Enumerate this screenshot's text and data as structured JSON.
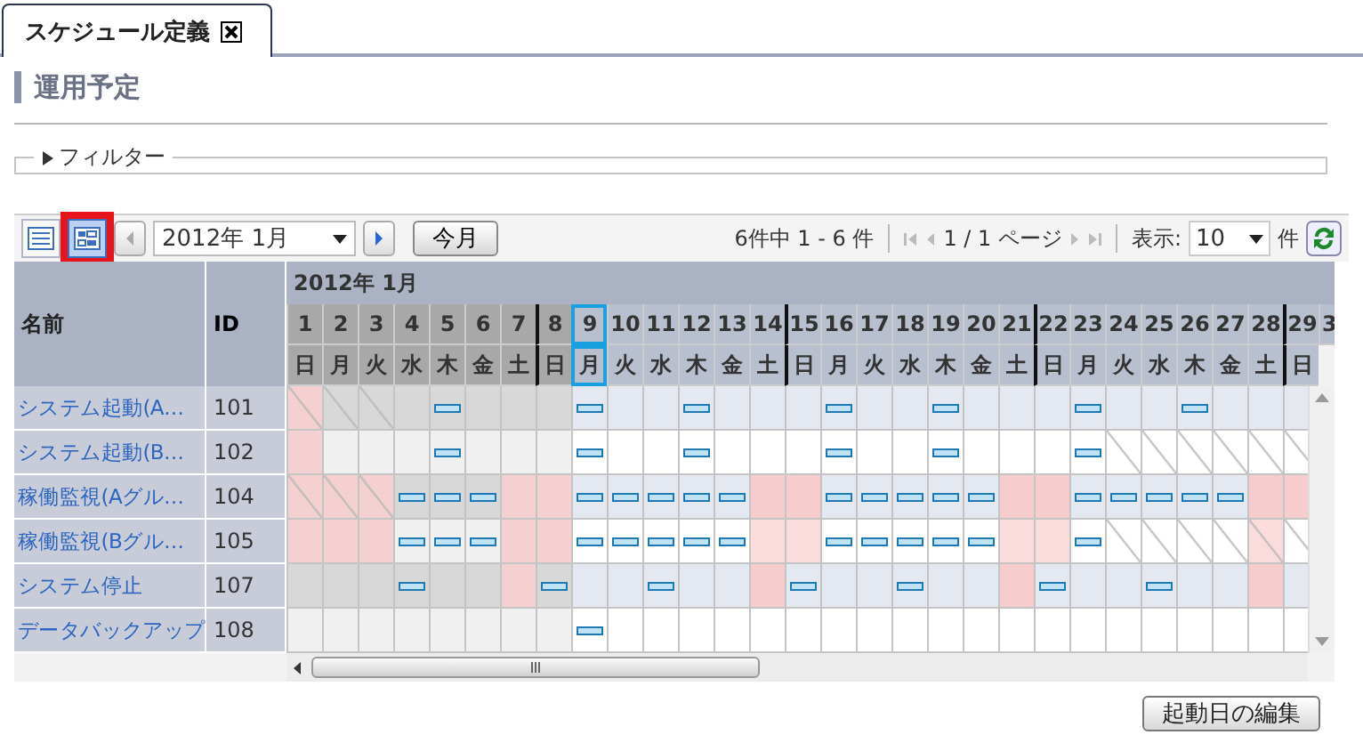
{
  "tab": {
    "label": "スケジュール定義",
    "selected": true
  },
  "heading": "運用予定",
  "filter": {
    "label": "フィルター",
    "expanded": false
  },
  "toolbar": {
    "views": [
      {
        "kind": "list",
        "selected": false,
        "highlighted": false
      },
      {
        "kind": "calendar",
        "selected": true,
        "highlighted": true
      }
    ],
    "month_select": "2012年  1月",
    "today_button": "今月",
    "count": "6件中 1 - 6 件",
    "page": "1 / 1 ページ",
    "page_size_label": "表示:",
    "page_size": "10",
    "page_size_unit": "件"
  },
  "calendar": {
    "name_header": "名前",
    "id_header": "ID",
    "month": "2012年  1月",
    "days": [
      {
        "date": "1",
        "weekday": "日",
        "past": true,
        "today": false,
        "week_start": false
      },
      {
        "date": "2",
        "weekday": "月",
        "past": true,
        "today": false,
        "week_start": false
      },
      {
        "date": "3",
        "weekday": "火",
        "past": true,
        "today": false,
        "week_start": false
      },
      {
        "date": "4",
        "weekday": "水",
        "past": true,
        "today": false,
        "week_start": false
      },
      {
        "date": "5",
        "weekday": "木",
        "past": true,
        "today": false,
        "week_start": false
      },
      {
        "date": "6",
        "weekday": "金",
        "past": true,
        "today": false,
        "week_start": false
      },
      {
        "date": "7",
        "weekday": "土",
        "past": true,
        "today": false,
        "week_start": false
      },
      {
        "date": "8",
        "weekday": "日",
        "past": true,
        "today": false,
        "week_start": true
      },
      {
        "date": "9",
        "weekday": "月",
        "past": false,
        "today": true,
        "week_start": false
      },
      {
        "date": "10",
        "weekday": "火",
        "past": false,
        "today": false,
        "week_start": false
      },
      {
        "date": "11",
        "weekday": "水",
        "past": false,
        "today": false,
        "week_start": false
      },
      {
        "date": "12",
        "weekday": "木",
        "past": false,
        "today": false,
        "week_start": false
      },
      {
        "date": "13",
        "weekday": "金",
        "past": false,
        "today": false,
        "week_start": false
      },
      {
        "date": "14",
        "weekday": "土",
        "past": false,
        "today": false,
        "week_start": false
      },
      {
        "date": "15",
        "weekday": "日",
        "past": false,
        "today": false,
        "week_start": true
      },
      {
        "date": "16",
        "weekday": "月",
        "past": false,
        "today": false,
        "week_start": false
      },
      {
        "date": "17",
        "weekday": "火",
        "past": false,
        "today": false,
        "week_start": false
      },
      {
        "date": "18",
        "weekday": "水",
        "past": false,
        "today": false,
        "week_start": false
      },
      {
        "date": "19",
        "weekday": "木",
        "past": false,
        "today": false,
        "week_start": false
      },
      {
        "date": "20",
        "weekday": "金",
        "past": false,
        "today": false,
        "week_start": false
      },
      {
        "date": "21",
        "weekday": "土",
        "past": false,
        "today": false,
        "week_start": false
      },
      {
        "date": "22",
        "weekday": "日",
        "past": false,
        "today": false,
        "week_start": true
      },
      {
        "date": "23",
        "weekday": "月",
        "past": false,
        "today": false,
        "week_start": false
      },
      {
        "date": "24",
        "weekday": "火",
        "past": false,
        "today": false,
        "week_start": false
      },
      {
        "date": "25",
        "weekday": "水",
        "past": false,
        "today": false,
        "week_start": false
      },
      {
        "date": "26",
        "weekday": "木",
        "past": false,
        "today": false,
        "week_start": false
      },
      {
        "date": "27",
        "weekday": "金",
        "past": false,
        "today": false,
        "week_start": false
      },
      {
        "date": "28",
        "weekday": "土",
        "past": false,
        "today": false,
        "week_start": false
      },
      {
        "date": "29",
        "weekday": "日",
        "past": false,
        "today": false,
        "week_start": true
      },
      {
        "date": "3",
        "past": false,
        "today": false,
        "week_start": false
      }
    ],
    "rows": [
      {
        "name": "システム起動(A…",
        "id": "101",
        "cells": [
          {
            "run": false,
            "holiday": true,
            "hatched": true
          },
          {
            "run": false,
            "holiday": false,
            "hatched": true
          },
          {
            "run": false,
            "holiday": false,
            "hatched": true
          },
          {
            "run": false,
            "holiday": false,
            "hatched": false
          },
          {
            "run": true,
            "holiday": false,
            "hatched": false
          },
          {
            "run": false,
            "holiday": false,
            "hatched": false
          },
          {
            "run": false,
            "holiday": false,
            "hatched": false
          },
          {
            "run": false,
            "holiday": false,
            "hatched": false
          },
          {
            "run": true,
            "holiday": false,
            "hatched": false
          },
          {
            "run": false,
            "holiday": false,
            "hatched": false
          },
          {
            "run": false,
            "holiday": false,
            "hatched": false
          },
          {
            "run": true,
            "holiday": false,
            "hatched": false
          },
          {
            "run": false,
            "holiday": false,
            "hatched": false
          },
          {
            "run": false,
            "holiday": false,
            "hatched": false
          },
          {
            "run": false,
            "holiday": false,
            "hatched": false
          },
          {
            "run": true,
            "holiday": false,
            "hatched": false
          },
          {
            "run": false,
            "holiday": false,
            "hatched": false
          },
          {
            "run": false,
            "holiday": false,
            "hatched": false
          },
          {
            "run": true,
            "holiday": false,
            "hatched": false
          },
          {
            "run": false,
            "holiday": false,
            "hatched": false
          },
          {
            "run": false,
            "holiday": false,
            "hatched": false
          },
          {
            "run": false,
            "holiday": false,
            "hatched": false
          },
          {
            "run": true,
            "holiday": false,
            "hatched": false
          },
          {
            "run": false,
            "holiday": false,
            "hatched": false
          },
          {
            "run": false,
            "holiday": false,
            "hatched": false
          },
          {
            "run": true,
            "holiday": false,
            "hatched": false
          },
          {
            "run": false,
            "holiday": false,
            "hatched": false
          },
          {
            "run": false,
            "holiday": false,
            "hatched": false
          },
          {
            "run": false,
            "holiday": false,
            "hatched": false
          }
        ]
      },
      {
        "name": "システム起動(B…",
        "id": "102",
        "cells": [
          {
            "run": false,
            "holiday": true,
            "hatched": false
          },
          {
            "run": false,
            "holiday": false,
            "hatched": false
          },
          {
            "run": false,
            "holiday": false,
            "hatched": false
          },
          {
            "run": false,
            "holiday": false,
            "hatched": false
          },
          {
            "run": true,
            "holiday": false,
            "hatched": false
          },
          {
            "run": false,
            "holiday": false,
            "hatched": false
          },
          {
            "run": false,
            "holiday": false,
            "hatched": false
          },
          {
            "run": false,
            "holiday": false,
            "hatched": false
          },
          {
            "run": true,
            "holiday": false,
            "hatched": false
          },
          {
            "run": false,
            "holiday": false,
            "hatched": false
          },
          {
            "run": false,
            "holiday": false,
            "hatched": false
          },
          {
            "run": true,
            "holiday": false,
            "hatched": false
          },
          {
            "run": false,
            "holiday": false,
            "hatched": false
          },
          {
            "run": false,
            "holiday": false,
            "hatched": false
          },
          {
            "run": false,
            "holiday": false,
            "hatched": false
          },
          {
            "run": true,
            "holiday": false,
            "hatched": false
          },
          {
            "run": false,
            "holiday": false,
            "hatched": false
          },
          {
            "run": false,
            "holiday": false,
            "hatched": false
          },
          {
            "run": true,
            "holiday": false,
            "hatched": false
          },
          {
            "run": false,
            "holiday": false,
            "hatched": false
          },
          {
            "run": false,
            "holiday": false,
            "hatched": false
          },
          {
            "run": false,
            "holiday": false,
            "hatched": false
          },
          {
            "run": true,
            "holiday": false,
            "hatched": false
          },
          {
            "run": false,
            "holiday": false,
            "hatched": true
          },
          {
            "run": false,
            "holiday": false,
            "hatched": true
          },
          {
            "run": false,
            "holiday": false,
            "hatched": true
          },
          {
            "run": false,
            "holiday": false,
            "hatched": true
          },
          {
            "run": false,
            "holiday": false,
            "hatched": true
          },
          {
            "run": false,
            "holiday": false,
            "hatched": true
          }
        ]
      },
      {
        "name": "稼働監視(Aグル…",
        "id": "104",
        "cells": [
          {
            "run": false,
            "holiday": true,
            "hatched": true
          },
          {
            "run": false,
            "holiday": true,
            "hatched": true
          },
          {
            "run": false,
            "holiday": true,
            "hatched": true
          },
          {
            "run": true,
            "holiday": false,
            "hatched": false
          },
          {
            "run": true,
            "holiday": false,
            "hatched": false
          },
          {
            "run": true,
            "holiday": false,
            "hatched": false
          },
          {
            "run": false,
            "holiday": true,
            "hatched": false
          },
          {
            "run": false,
            "holiday": true,
            "hatched": false
          },
          {
            "run": true,
            "holiday": false,
            "hatched": false
          },
          {
            "run": true,
            "holiday": false,
            "hatched": false
          },
          {
            "run": true,
            "holiday": false,
            "hatched": false
          },
          {
            "run": true,
            "holiday": false,
            "hatched": false
          },
          {
            "run": true,
            "holiday": false,
            "hatched": false
          },
          {
            "run": false,
            "holiday": true,
            "hatched": false
          },
          {
            "run": false,
            "holiday": true,
            "hatched": false
          },
          {
            "run": true,
            "holiday": false,
            "hatched": false
          },
          {
            "run": true,
            "holiday": false,
            "hatched": false
          },
          {
            "run": true,
            "holiday": false,
            "hatched": false
          },
          {
            "run": true,
            "holiday": false,
            "hatched": false
          },
          {
            "run": true,
            "holiday": false,
            "hatched": false
          },
          {
            "run": false,
            "holiday": true,
            "hatched": false
          },
          {
            "run": false,
            "holiday": true,
            "hatched": false
          },
          {
            "run": true,
            "holiday": false,
            "hatched": false
          },
          {
            "run": true,
            "holiday": false,
            "hatched": false
          },
          {
            "run": true,
            "holiday": false,
            "hatched": false
          },
          {
            "run": true,
            "holiday": false,
            "hatched": false
          },
          {
            "run": true,
            "holiday": false,
            "hatched": false
          },
          {
            "run": false,
            "holiday": true,
            "hatched": false
          },
          {
            "run": false,
            "holiday": true,
            "hatched": false
          }
        ]
      },
      {
        "name": "稼働監視(Bグル…",
        "id": "105",
        "cells": [
          {
            "run": false,
            "holiday": true,
            "hatched": false
          },
          {
            "run": false,
            "holiday": true,
            "hatched": false
          },
          {
            "run": false,
            "holiday": true,
            "hatched": false
          },
          {
            "run": true,
            "holiday": false,
            "hatched": false
          },
          {
            "run": true,
            "holiday": false,
            "hatched": false
          },
          {
            "run": true,
            "holiday": false,
            "hatched": false
          },
          {
            "run": false,
            "holiday": true,
            "hatched": false
          },
          {
            "run": false,
            "holiday": true,
            "hatched": false
          },
          {
            "run": true,
            "holiday": false,
            "hatched": false
          },
          {
            "run": true,
            "holiday": false,
            "hatched": false
          },
          {
            "run": true,
            "holiday": false,
            "hatched": false
          },
          {
            "run": true,
            "holiday": false,
            "hatched": false
          },
          {
            "run": true,
            "holiday": false,
            "hatched": false
          },
          {
            "run": false,
            "holiday": true,
            "hatched": false
          },
          {
            "run": false,
            "holiday": true,
            "hatched": false
          },
          {
            "run": true,
            "holiday": false,
            "hatched": false
          },
          {
            "run": true,
            "holiday": false,
            "hatched": false
          },
          {
            "run": true,
            "holiday": false,
            "hatched": false
          },
          {
            "run": true,
            "holiday": false,
            "hatched": false
          },
          {
            "run": true,
            "holiday": false,
            "hatched": false
          },
          {
            "run": false,
            "holiday": true,
            "hatched": false
          },
          {
            "run": false,
            "holiday": true,
            "hatched": false
          },
          {
            "run": true,
            "holiday": false,
            "hatched": false
          },
          {
            "run": false,
            "holiday": false,
            "hatched": true
          },
          {
            "run": false,
            "holiday": false,
            "hatched": true
          },
          {
            "run": false,
            "holiday": false,
            "hatched": true
          },
          {
            "run": false,
            "holiday": false,
            "hatched": true
          },
          {
            "run": false,
            "holiday": true,
            "hatched": true
          },
          {
            "run": false,
            "holiday": false,
            "hatched": true
          }
        ]
      },
      {
        "name": "システム停止",
        "id": "107",
        "cells": [
          {
            "run": false,
            "holiday": false,
            "hatched": false
          },
          {
            "run": false,
            "holiday": false,
            "hatched": false
          },
          {
            "run": false,
            "holiday": false,
            "hatched": false
          },
          {
            "run": true,
            "holiday": false,
            "hatched": false
          },
          {
            "run": false,
            "holiday": false,
            "hatched": false
          },
          {
            "run": false,
            "holiday": false,
            "hatched": false
          },
          {
            "run": false,
            "holiday": true,
            "hatched": false
          },
          {
            "run": true,
            "holiday": false,
            "hatched": false
          },
          {
            "run": false,
            "holiday": false,
            "hatched": false
          },
          {
            "run": false,
            "holiday": false,
            "hatched": false
          },
          {
            "run": true,
            "holiday": false,
            "hatched": false
          },
          {
            "run": false,
            "holiday": false,
            "hatched": false
          },
          {
            "run": false,
            "holiday": false,
            "hatched": false
          },
          {
            "run": false,
            "holiday": true,
            "hatched": false
          },
          {
            "run": true,
            "holiday": false,
            "hatched": false
          },
          {
            "run": false,
            "holiday": false,
            "hatched": false
          },
          {
            "run": false,
            "holiday": false,
            "hatched": false
          },
          {
            "run": true,
            "holiday": false,
            "hatched": false
          },
          {
            "run": false,
            "holiday": false,
            "hatched": false
          },
          {
            "run": false,
            "holiday": false,
            "hatched": false
          },
          {
            "run": false,
            "holiday": true,
            "hatched": false
          },
          {
            "run": true,
            "holiday": false,
            "hatched": false
          },
          {
            "run": false,
            "holiday": false,
            "hatched": false
          },
          {
            "run": false,
            "holiday": false,
            "hatched": false
          },
          {
            "run": true,
            "holiday": false,
            "hatched": false
          },
          {
            "run": false,
            "holiday": false,
            "hatched": false
          },
          {
            "run": false,
            "holiday": false,
            "hatched": false
          },
          {
            "run": false,
            "holiday": true,
            "hatched": false
          },
          {
            "run": false,
            "holiday": false,
            "hatched": false
          }
        ]
      },
      {
        "name": "データバックアップ",
        "id": "108",
        "cells": [
          {
            "run": false,
            "holiday": false,
            "hatched": false
          },
          {
            "run": false,
            "holiday": false,
            "hatched": false
          },
          {
            "run": false,
            "holiday": false,
            "hatched": false
          },
          {
            "run": false,
            "holiday": false,
            "hatched": false
          },
          {
            "run": false,
            "holiday": false,
            "hatched": false
          },
          {
            "run": false,
            "holiday": false,
            "hatched": false
          },
          {
            "run": false,
            "holiday": false,
            "hatched": false
          },
          {
            "run": false,
            "holiday": false,
            "hatched": false
          },
          {
            "run": true,
            "holiday": false,
            "hatched": false
          },
          {
            "run": false,
            "holiday": false,
            "hatched": false
          },
          {
            "run": false,
            "holiday": false,
            "hatched": false
          },
          {
            "run": false,
            "holiday": false,
            "hatched": false
          },
          {
            "run": false,
            "holiday": false,
            "hatched": false
          },
          {
            "run": false,
            "holiday": false,
            "hatched": false
          },
          {
            "run": false,
            "holiday": false,
            "hatched": false
          },
          {
            "run": false,
            "holiday": false,
            "hatched": false
          },
          {
            "run": false,
            "holiday": false,
            "hatched": false
          },
          {
            "run": false,
            "holiday": false,
            "hatched": false
          },
          {
            "run": false,
            "holiday": false,
            "hatched": false
          },
          {
            "run": false,
            "holiday": false,
            "hatched": false
          },
          {
            "run": false,
            "holiday": false,
            "hatched": false
          },
          {
            "run": false,
            "holiday": false,
            "hatched": false
          },
          {
            "run": false,
            "holiday": false,
            "hatched": false
          },
          {
            "run": false,
            "holiday": false,
            "hatched": false
          },
          {
            "run": false,
            "holiday": false,
            "hatched": false
          },
          {
            "run": false,
            "holiday": false,
            "hatched": false
          },
          {
            "run": false,
            "holiday": false,
            "hatched": false
          },
          {
            "run": false,
            "holiday": false,
            "hatched": false
          },
          {
            "run": false,
            "holiday": false,
            "hatched": false
          }
        ]
      }
    ]
  },
  "edit_button": "起動日の編集"
}
